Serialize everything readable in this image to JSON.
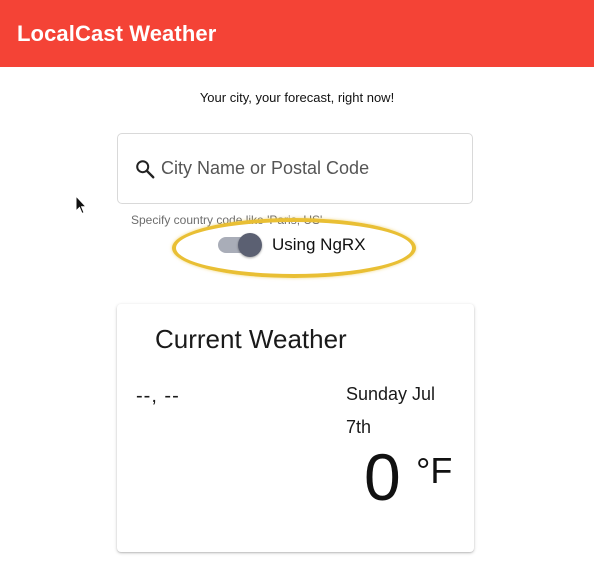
{
  "toolbar": {
    "title": "LocalCast Weather",
    "color": "#f44336"
  },
  "tagline": "Your city, your forecast, right now!",
  "search": {
    "icon": "search-icon",
    "placeholder": "City Name or Postal Code",
    "value": "",
    "hint": "Specify country code like 'Paris, US'"
  },
  "ngrx_toggle": {
    "label": "Using NgRX",
    "checked": true
  },
  "current_weather": {
    "title": "Current Weather",
    "location": "--, --",
    "date": "Sunday Jul 7th",
    "temperature": "0",
    "unit": "°F"
  }
}
